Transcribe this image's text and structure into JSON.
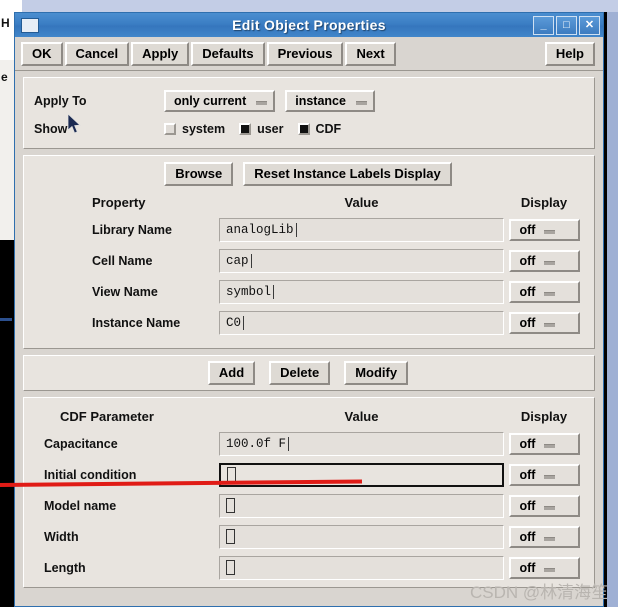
{
  "window": {
    "title": "Edit Object Properties",
    "minimize_label": "_",
    "maximize_label": "□",
    "close_label": "✕"
  },
  "toolbar": {
    "buttons": [
      {
        "label": "OK"
      },
      {
        "label": "Cancel"
      },
      {
        "label": "Apply"
      },
      {
        "label": "Defaults"
      },
      {
        "label": "Previous"
      },
      {
        "label": "Next"
      }
    ],
    "help_label": "Help"
  },
  "apply_to": {
    "label": "Apply To",
    "scope_value": "only current",
    "target_value": "instance",
    "show_label": "Show",
    "checkboxes": [
      {
        "label": "system",
        "checked": false
      },
      {
        "label": "user",
        "checked": true
      },
      {
        "label": "CDF",
        "checked": true
      }
    ]
  },
  "property_section": {
    "browse_label": "Browse",
    "reset_label": "Reset Instance Labels Display",
    "headers": {
      "property": "Property",
      "value": "Value",
      "display": "Display"
    },
    "rows": [
      {
        "label": "Library Name",
        "value": "analogLib",
        "display": "off"
      },
      {
        "label": "Cell Name",
        "value": "cap",
        "display": "off"
      },
      {
        "label": "View Name",
        "value": "symbol",
        "display": "off"
      },
      {
        "label": "Instance Name",
        "value": "C0",
        "display": "off"
      }
    ]
  },
  "actions": {
    "add_label": "Add",
    "delete_label": "Delete",
    "modify_label": "Modify"
  },
  "cdf_section": {
    "headers": {
      "parameter": "CDF Parameter",
      "value": "Value",
      "display": "Display"
    },
    "rows": [
      {
        "label": "Capacitance",
        "value": "100.0f F",
        "display": "off",
        "focused": false
      },
      {
        "label": "Initial condition",
        "value": "",
        "display": "off",
        "focused": true
      },
      {
        "label": "Model name",
        "value": "",
        "display": "off",
        "focused": false
      },
      {
        "label": "Width",
        "value": "",
        "display": "off",
        "focused": false
      },
      {
        "label": "Length",
        "value": "",
        "display": "off",
        "focused": false
      }
    ]
  },
  "background": {
    "fragment_top": "H",
    "fragment_bottom": "e"
  },
  "annotations": {
    "watermark": "CSDN @林清海笙",
    "underline_color": "#e01b16"
  },
  "colors": {
    "titlebar": "#3b7ec4",
    "dialog_bg": "#d9d5d0",
    "panel_bg": "#e8e4df",
    "field_bg": "#e4e0db",
    "accent_red": "#e01b16"
  }
}
